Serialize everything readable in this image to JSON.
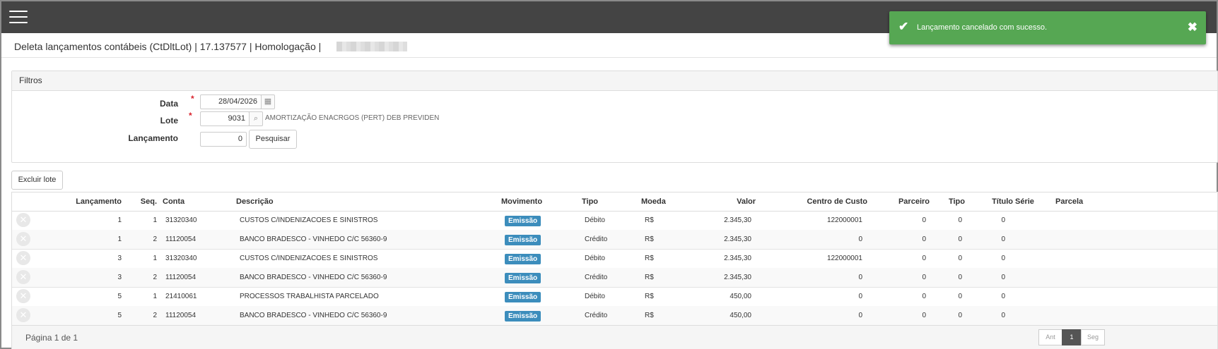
{
  "topbar": {
    "menu_icon": "hamburger-menu-icon"
  },
  "toast": {
    "icon": "check-icon",
    "message": "Lançamento cancelado com sucesso.",
    "close_icon": "close-icon",
    "color": "#56a753"
  },
  "header": {
    "title": "Deleta lançamentos contábeis (CtDltLot) | 17.137577 | Homologação |"
  },
  "filters": {
    "title": "Filtros",
    "data_label": "Data",
    "data_value": "28/04/2026",
    "calendar_icon": "calendar-icon",
    "lote_label": "Lote",
    "lote_value": "9031",
    "lote_search_icon": "search-icon",
    "lote_description": "AMORTIZAÇÃO ENACRGOS (PERT) DEB PREVIDEN",
    "lancamento_label": "Lançamento",
    "lancamento_value": "0",
    "search_button": "Pesquisar",
    "required_mark": "*"
  },
  "actions": {
    "delete_lot_button": "Excluir lote"
  },
  "table": {
    "columns": [
      "Lançamento",
      "Seq.",
      "Conta",
      "Descrição",
      "Movimento",
      "Tipo",
      "Moeda",
      "Valor",
      "Centro de Custo",
      "Parceiro",
      "Tipo",
      "Título",
      "Série",
      "Parcela"
    ],
    "delete_icon": "close-circle-icon",
    "rows": [
      {
        "delete": "✕",
        "lancamento": "1",
        "seq": "1",
        "conta": "31320340",
        "descricao": "CUSTOS C/INDENIZACOES E SINISTROS",
        "movimento": "Emissão",
        "tipo": "Débito",
        "moeda": "R$",
        "valor": "2.345,30",
        "centro": "122000001",
        "parceiro": "0",
        "tipo2": "0",
        "titulo": "0"
      },
      {
        "delete": "✕",
        "lancamento": "1",
        "seq": "2",
        "conta": "11120054",
        "descricao": "BANCO BRADESCO - VINHEDO C/C 56360-9",
        "movimento": "Emissão",
        "tipo": "Crédito",
        "moeda": "R$",
        "valor": "2.345,30",
        "centro": "0",
        "parceiro": "0",
        "tipo2": "0",
        "titulo": "0"
      },
      {
        "delete": "✕",
        "lancamento": "3",
        "seq": "1",
        "conta": "31320340",
        "descricao": "CUSTOS C/INDENIZACOES E SINISTROS",
        "movimento": "Emissão",
        "tipo": "Débito",
        "moeda": "R$",
        "valor": "2.345,30",
        "centro": "122000001",
        "parceiro": "0",
        "tipo2": "0",
        "titulo": "0"
      },
      {
        "delete": "✕",
        "lancamento": "3",
        "seq": "2",
        "conta": "11120054",
        "descricao": "BANCO BRADESCO - VINHEDO C/C 56360-9",
        "movimento": "Emissão",
        "tipo": "Crédito",
        "moeda": "R$",
        "valor": "2.345,30",
        "centro": "0",
        "parceiro": "0",
        "tipo2": "0",
        "titulo": "0"
      },
      {
        "delete": "✕",
        "lancamento": "5",
        "seq": "1",
        "conta": "21410061",
        "descricao": "PROCESSOS TRABALHISTA PARCELADO",
        "movimento": "Emissão",
        "tipo": "Débito",
        "moeda": "R$",
        "valor": "450,00",
        "centro": "0",
        "parceiro": "0",
        "tipo2": "0",
        "titulo": "0"
      },
      {
        "delete": "✕",
        "lancamento": "5",
        "seq": "2",
        "conta": "11120054",
        "descricao": "BANCO BRADESCO - VINHEDO C/C 56360-9",
        "movimento": "Emissão",
        "tipo": "Crédito",
        "moeda": "R$",
        "valor": "450,00",
        "centro": "0",
        "parceiro": "0",
        "tipo2": "0",
        "titulo": "0"
      }
    ]
  },
  "pagination": {
    "label": "Página 1 de 1",
    "prev": "Ant",
    "current": "1",
    "next": "Seg"
  },
  "colors": {
    "topbar": "#444444",
    "badge": "#3c8dbc",
    "required": "#d9232d"
  }
}
